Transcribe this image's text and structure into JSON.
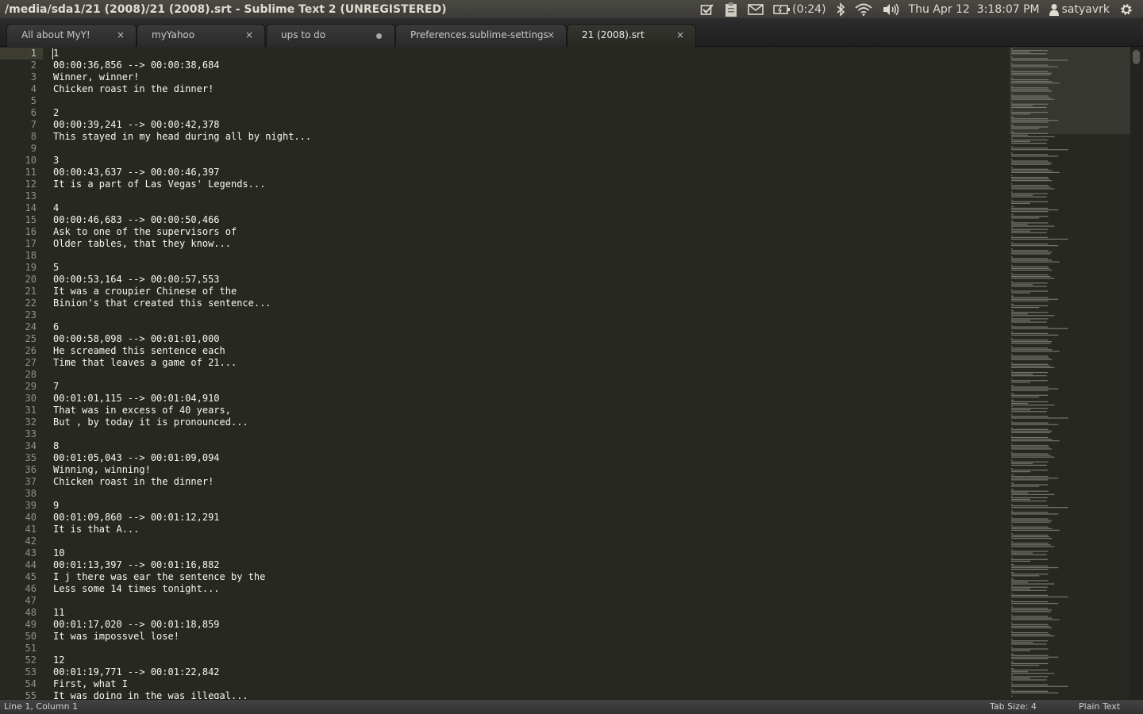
{
  "window": {
    "title": "/media/sda1/21 (2008)/21 (2008).srt - Sublime Text 2 (UNREGISTERED)"
  },
  "panel": {
    "battery_time": "(0:24)",
    "clock": "Thu Apr 12  3:18:07 PM",
    "user": "satyavrk",
    "icons": [
      "checkbox-icon",
      "clipboard-icon",
      "mail-icon",
      "battery-icon",
      "bluetooth-icon",
      "wifi-icon",
      "volume-icon",
      "user-icon",
      "gear-icon"
    ]
  },
  "tabs": [
    {
      "label": "All about MyY!",
      "state": "close"
    },
    {
      "label": "myYahoo",
      "state": "close"
    },
    {
      "label": "ups to do",
      "state": "modified"
    },
    {
      "label": "Preferences.sublime-settings",
      "state": "close"
    },
    {
      "label": "21 (2008).srt",
      "state": "close",
      "active": true
    }
  ],
  "tab_close_glyph": "×",
  "editor": {
    "current_line": 1,
    "lines": [
      "1",
      "00:00:36,856 --> 00:00:38,684",
      "Winner, winner!",
      "Chicken roast in the dinner!",
      "",
      "2",
      "00:00:39,241 --> 00:00:42,378",
      "This stayed in my head during all by night...",
      "",
      "3",
      "00:00:43,637 --> 00:00:46,397",
      "It is a part of Las Vegas' Legends...",
      "",
      "4",
      "00:00:46,683 --> 00:00:50,466",
      "Ask to one of the supervisors of",
      "Older tables, that they know...",
      "",
      "5",
      "00:00:53,164 --> 00:00:57,553",
      "It was a croupier Chinese of the",
      "Binion's that created this sentence...",
      "",
      "6",
      "00:00:58,098 --> 00:01:01,000",
      "He screamed this sentence each",
      "Time that leaves a game of 21...",
      "",
      "7",
      "00:01:01,115 --> 00:01:04,910",
      "That was in excess of 40 years,",
      "But , by today it is pronounced...",
      "",
      "8",
      "00:01:05,043 --> 00:01:09,094",
      "Winning, winning!",
      "Chicken roast in the dinner!",
      "",
      "9",
      "00:01:09,860 --> 00:01:12,291",
      "It is that A...",
      "",
      "10",
      "00:01:13,397 --> 00:01:16,882",
      "I j there was ear the sentence by the",
      "Less some 14 times tonight...",
      "",
      "11",
      "00:01:17,020 --> 00:01:18,859",
      "It was impossvel lose!",
      "",
      "12",
      "00:01:19,771 --> 00:01:22,842",
      "First, what I",
      "It was doing in the was illegal..."
    ]
  },
  "status": {
    "position": "Line 1, Column 1",
    "tab_size": "Tab Size: 4",
    "syntax": "Plain Text"
  }
}
